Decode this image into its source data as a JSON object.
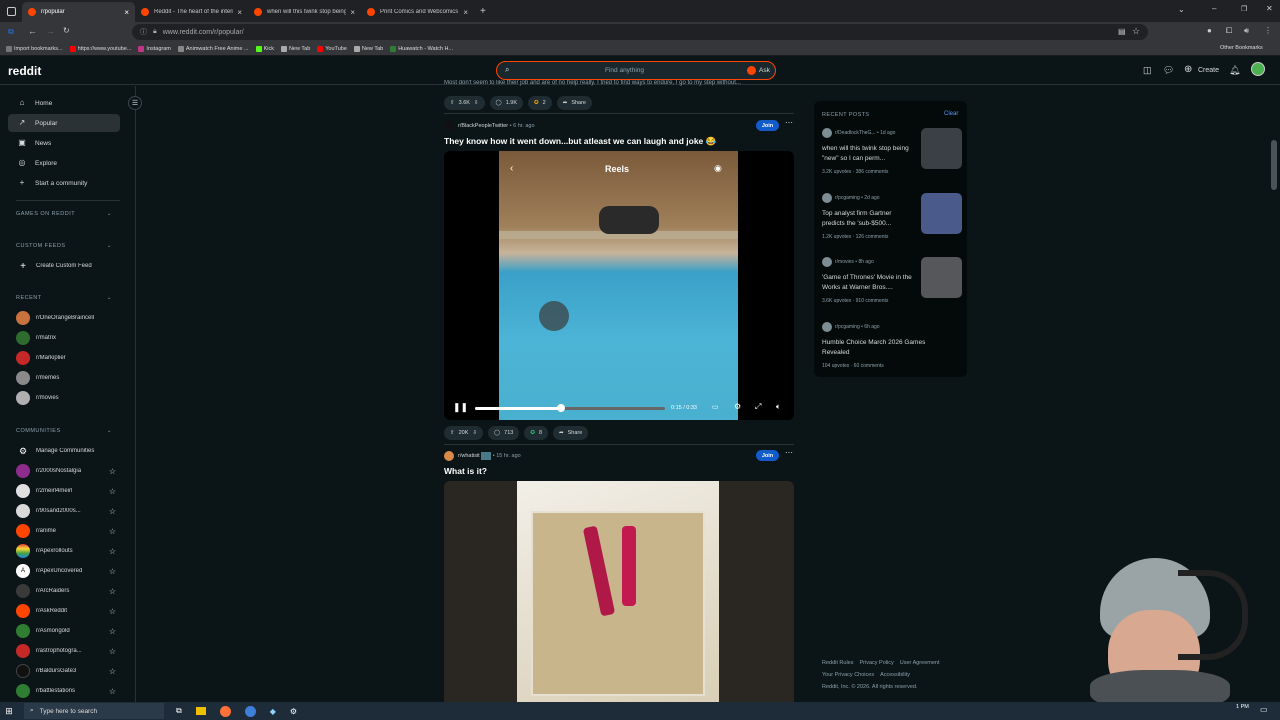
{
  "browser": {
    "tabs": [
      {
        "title": "r/popular",
        "active": true
      },
      {
        "title": "Reddit - The heart of the intern",
        "active": false
      },
      {
        "title": "when will this twink stop being",
        "active": false
      },
      {
        "title": "Print Comics and Webcomics",
        "active": false
      }
    ],
    "new_tab": "+",
    "url": "www.reddit.com/r/popular/",
    "bookmarks": [
      "Import bookmarks...",
      "https://www.youtube...",
      "Instagram",
      "Animwatch Free Anime ...",
      "Kick",
      "New Tab",
      "YouTube",
      "New Tab",
      "Huawatch - Watch H..."
    ],
    "other_bookmarks": "Other Bookmarks"
  },
  "header": {
    "logo": "reddit",
    "search_placeholder": "Find anything",
    "ask_label": "Ask",
    "create_label": "Create"
  },
  "sidebar": {
    "nav": [
      {
        "label": "Home",
        "icon": "home-icon"
      },
      {
        "label": "Popular",
        "icon": "popular-icon"
      },
      {
        "label": "News",
        "icon": "news-icon"
      },
      {
        "label": "Explore",
        "icon": "explore-icon"
      },
      {
        "label": "Start a community",
        "icon": "plus-icon"
      }
    ],
    "games_header": "GAMES ON REDDIT",
    "custom_feeds_header": "CUSTOM FEEDS",
    "create_custom_feed": "Create Custom Feed",
    "recent_header": "RECENT",
    "recent": [
      "r/OneOrangeBraincell",
      "r/matrix",
      "r/Markiplier",
      "r/memes",
      "r/movies"
    ],
    "communities_header": "COMMUNITIES",
    "manage_communities": "Manage Communities",
    "communities": [
      "r/2000sNostalgia",
      "r/2meirl4meirl",
      "r/90sand2000s...",
      "r/anime",
      "r/Apexrollouts",
      "r/ApexUncovered",
      "r/ArcRaiders",
      "r/AskReddit",
      "r/Asmongold",
      "r/astrophotogra...",
      "r/BaldursGate3",
      "r/battlestations"
    ]
  },
  "feed": {
    "prev_post_text": "Most don't seem to like their job and are of no help really. I tried to find ways to endure, I go to my step without...",
    "prev_actions": {
      "votes": "3.6K",
      "comments": "1.9K",
      "awards": "2",
      "share": "Share"
    },
    "post1": {
      "subreddit": "r/BlackPeopleTwitter",
      "age": "6 hr. ago",
      "join": "Join",
      "title": "They know how it went down...but atleast we can laugh and joke 😂",
      "video_label": "Reels",
      "time": "0:15 / 0:33",
      "progress": 0.45,
      "votes": "20K",
      "comments": "713",
      "awards": "8",
      "share": "Share"
    },
    "post2": {
      "subreddit": "r/whatisit",
      "age": "15 hr. ago",
      "join": "Join",
      "title": "What is it?"
    }
  },
  "recent_posts": {
    "header": "RECENT POSTS",
    "clear": "Clear",
    "items": [
      {
        "sub": "r/DeadlockTheG...",
        "age": "1d ago",
        "title": "when will this twink stop being \"new\" so I can perm...",
        "stats": "3.2K upvotes · 386 comments",
        "thumb": "#3a4045"
      },
      {
        "sub": "r/pcgaming",
        "age": "2d ago",
        "title": "Top analyst firm Gartner predicts the 'sub-$500...",
        "stats": "1.2K upvotes · 126 comments",
        "thumb": "#4a5a8a"
      },
      {
        "sub": "r/movies",
        "age": "8h ago",
        "title": "'Game of Thrones' Movie in the Works at Warner Bros....",
        "stats": "3.6K upvotes · 910 comments",
        "thumb": "#55575a"
      },
      {
        "sub": "r/pcgaming",
        "age": "6h ago",
        "title": "Humble Choice March 2026 Games Revealed",
        "stats": "104 upvotes · 60 comments",
        "thumb": ""
      }
    ]
  },
  "footer": {
    "links1": [
      "Reddit Rules",
      "Privacy Policy",
      "User Agreement"
    ],
    "links2": [
      "Your Privacy Choices",
      "Accessibility"
    ],
    "copyright": "Reddit, Inc. © 2026. All rights reserved."
  },
  "taskbar": {
    "search_placeholder": "Type here to search",
    "time": "1 PM"
  },
  "colors": {
    "accent": "#ff4500",
    "join": "#115bca",
    "bg": "#0b1416"
  }
}
